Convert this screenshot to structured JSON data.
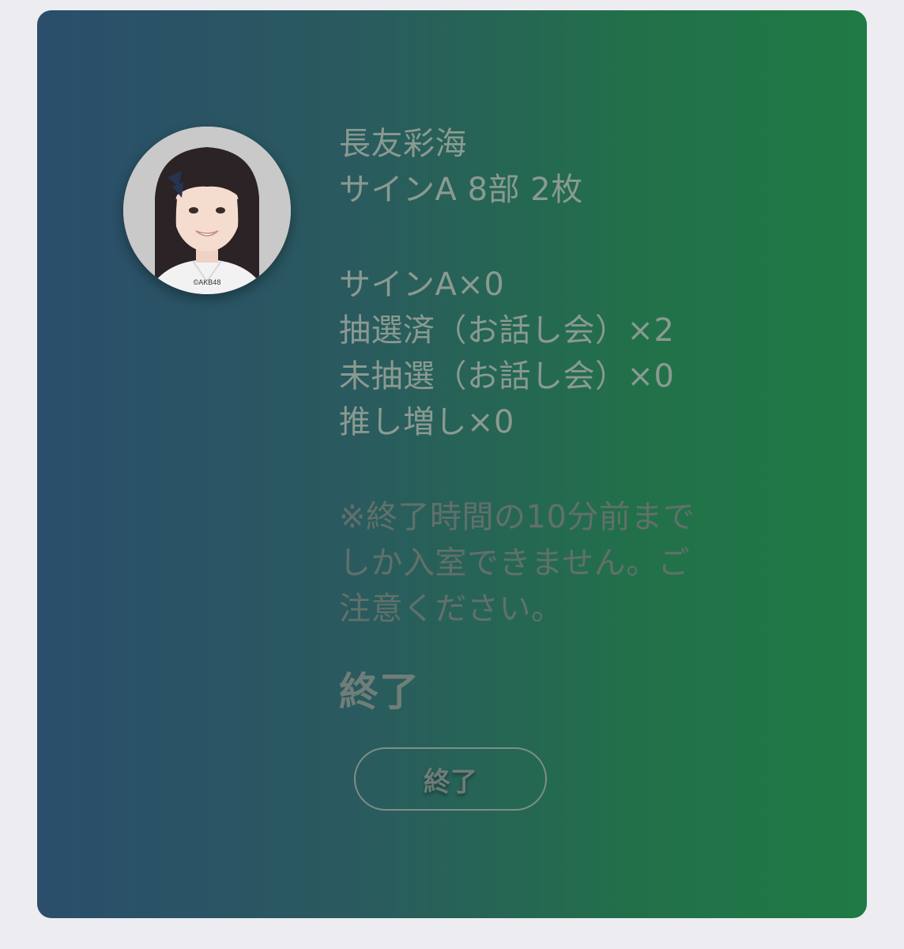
{
  "card": {
    "gradient_start": "#2a4e6b",
    "gradient_end": "#1f7a44"
  },
  "avatar": {
    "icon": "member-photo",
    "credit": "©AKB48"
  },
  "info": {
    "member_name": "長友彩海",
    "session": "サインA 8部 2枚",
    "tickets": [
      "サインA×0",
      "抽選済（お話し会）×2",
      "未抽選（お話し会）×0",
      "推し増し×0"
    ],
    "notice_lines": [
      "※終了時間の10分前まで",
      "しか入室できません。ご",
      "注意ください。"
    ]
  },
  "status": {
    "label": "終了"
  },
  "button": {
    "label": "終了"
  }
}
